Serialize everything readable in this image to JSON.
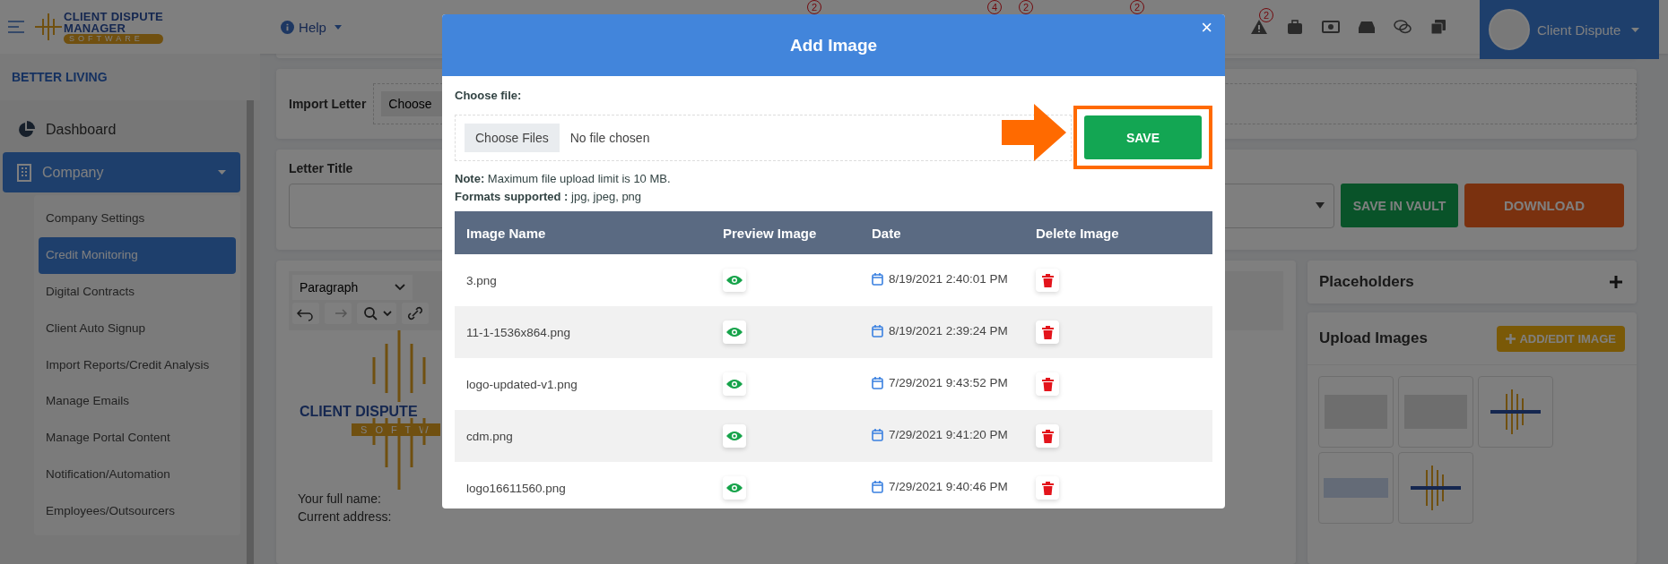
{
  "topbar": {
    "logo": {
      "line1": "CLIENT DISPUTE",
      "line2": "MANAGER",
      "line3": "SOFTWARE"
    },
    "help": "Help",
    "hidden_badges": [
      "2",
      "4",
      "2",
      "2"
    ],
    "icons": [
      {
        "kind": "warning",
        "badge": "2"
      },
      {
        "kind": "briefcase"
      },
      {
        "kind": "money"
      },
      {
        "kind": "inbox"
      },
      {
        "kind": "chat"
      },
      {
        "kind": "copy"
      }
    ],
    "user": "Client Dispute"
  },
  "sidebar": {
    "company_name": "BETTER LIVING",
    "items": [
      {
        "label": "Dashboard",
        "kind": "pie",
        "selected": false
      },
      {
        "label": "Company",
        "kind": "building",
        "selected": true,
        "expanded": true,
        "children": [
          {
            "label": "Company Settings",
            "selected": false
          },
          {
            "label": "Credit Monitoring",
            "selected": true
          },
          {
            "label": "Digital Contracts",
            "selected": false
          },
          {
            "label": "Client Auto Signup",
            "selected": false
          },
          {
            "label": "Import Reports/Credit Analysis",
            "selected": false
          },
          {
            "label": "Manage Emails",
            "selected": false
          },
          {
            "label": "Manage Portal Content",
            "selected": false
          },
          {
            "label": "Notification/Automation",
            "selected": false
          },
          {
            "label": "Employees/Outsourcers",
            "selected": false
          }
        ]
      }
    ]
  },
  "import_letter": {
    "label": "Import Letter",
    "button": "Choose"
  },
  "letter_title": {
    "label": "Letter Title"
  },
  "actions": [
    {
      "label": "SAVE IN VAULT",
      "kind": "save"
    },
    {
      "label": "DOWNLOAD",
      "kind": "download"
    }
  ],
  "editor": {
    "block_format": "Paragraph",
    "logo": {
      "line1": "CLIENT DISPUTE",
      "line2": "S O F T W"
    },
    "lines": [
      "Your full name:",
      "Current address:"
    ]
  },
  "placeholders": {
    "title": "Placeholders"
  },
  "upload_images": {
    "title": "Upload Images",
    "button": "ADD/EDIT IMAGE",
    "thumbnails": [
      {
        "kind": "photo"
      },
      {
        "kind": "photo"
      },
      {
        "kind": "logo"
      },
      {
        "kind": "screenshot"
      },
      {
        "kind": "logo"
      }
    ]
  },
  "modal": {
    "title": "Add Image",
    "close": "×",
    "file_label": "Choose file:",
    "file_button": "Choose Files",
    "file_status": "No file chosen",
    "save": "SAVE",
    "save_highlighted": true,
    "note": "**Note:** Maximum file upload limit is 10 MB.",
    "formats": "**Formats supported :** jpg, jpeg, png",
    "columns": [
      "Image Name",
      "Preview Image",
      "Date",
      "Delete Image"
    ],
    "rows": [
      {
        "name": "3.png",
        "date": "8/19/2021 2:40:01 PM"
      },
      {
        "name": "11-1-1536x864.png",
        "date": "8/19/2021 2:39:24 PM"
      },
      {
        "name": "logo-updated-v1.png",
        "date": "7/29/2021 9:43:52 PM"
      },
      {
        "name": "cdm.png",
        "date": "7/29/2021 9:41:20 PM"
      },
      {
        "name": "logo16611560.png",
        "date": "7/29/2021 9:40:46 PM"
      }
    ]
  }
}
